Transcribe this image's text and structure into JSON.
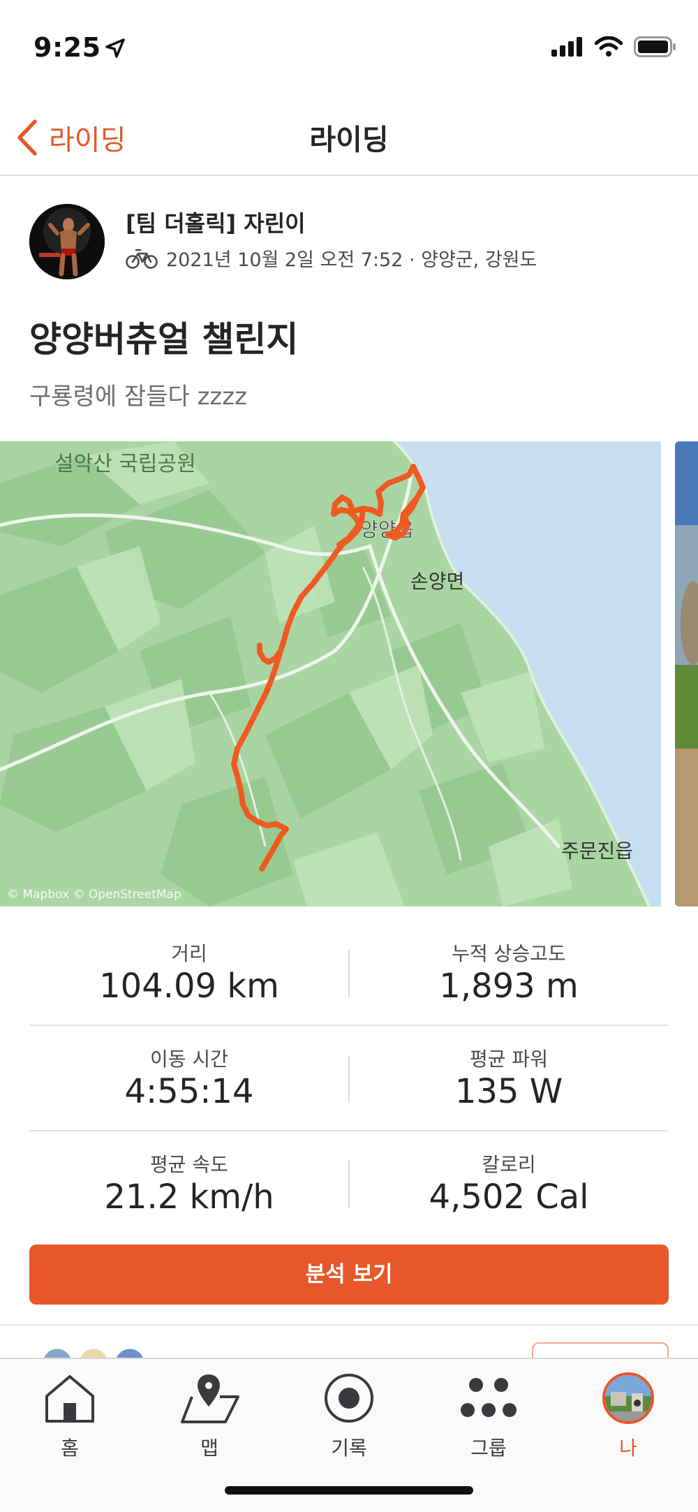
{
  "status_bar": {
    "time": "9:25"
  },
  "nav": {
    "back_label": "라이딩",
    "title": "라이딩"
  },
  "activity": {
    "athlete": "[팀 더홀릭] 자린이",
    "meta": "2021년 10월 2일 오전 7:52 · 양양군, 강원도",
    "title": "양양버츄얼 챌린지",
    "description": "구룡령에 잠들다 zzzz"
  },
  "map": {
    "labels": {
      "park": "설악산 국립공원",
      "town1": "양양읍",
      "town2": "손양면",
      "town3": "주문진읍",
      "attribution": "© Mapbox © OpenStreetMap"
    },
    "route_color": "#f05a22"
  },
  "stats": [
    {
      "left": {
        "label": "거리",
        "value": "104.09 km"
      },
      "right": {
        "label": "누적 상승고도",
        "value": "1,893 m"
      }
    },
    {
      "left": {
        "label": "이동 시간",
        "value": "4:55:14"
      },
      "right": {
        "label": "평균 파워",
        "value": "135 W"
      }
    },
    {
      "left": {
        "label": "평균 속도",
        "value": "21.2 km/h"
      },
      "right": {
        "label": "칼로리",
        "value": "4,502 Cal"
      }
    }
  ],
  "analysis_button": "분석 보기",
  "tabs": [
    {
      "label": "홈",
      "icon": "home-icon"
    },
    {
      "label": "맵",
      "icon": "map-icon"
    },
    {
      "label": "기록",
      "icon": "record-icon"
    },
    {
      "label": "그룹",
      "icon": "groups-icon"
    },
    {
      "label": "나",
      "icon": "profile-avatar-icon",
      "active": true
    }
  ],
  "colors": {
    "accent": "#e8572a",
    "text": "#242428",
    "water": "#c6dff0",
    "land": "#a9d8a3"
  }
}
